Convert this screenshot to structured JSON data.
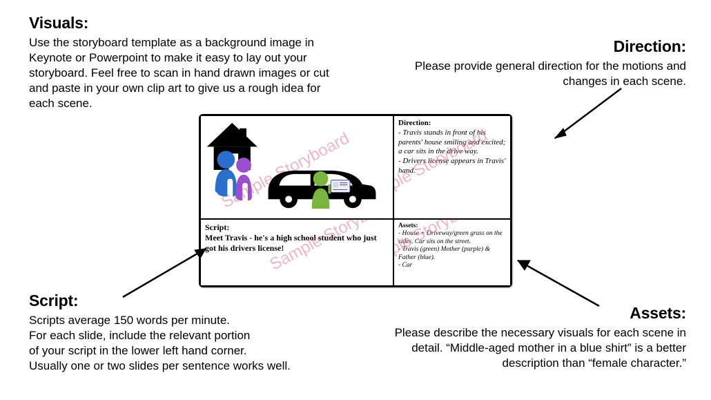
{
  "callouts": {
    "visuals": {
      "heading": "Visuals:",
      "body": "Use the storyboard template as a background image in Keynote or Powerpoint to make it easy to lay out your storyboard. Feel free to scan in hand drawn images or cut and paste in your own clip art to give us a rough idea for each scene."
    },
    "direction": {
      "heading": "Direction:",
      "body": "Please provide general direction for the motions and changes in each scene."
    },
    "script": {
      "heading": "Script:",
      "body": "Scripts average 150 words per minute.\nFor each slide, include the relevant portion\nof your script in the lower left hand corner.\nUsually one or two slides per sentence works well."
    },
    "assets": {
      "heading": "Assets:",
      "body": "Please describe the necessary visuals for each scene in detail. “Middle-aged mother in a blue shirt” is a better description than “female character.”"
    }
  },
  "storyboard": {
    "watermark_text": "Sample Storyboard",
    "direction": {
      "label": "Direction:",
      "body": "- Travis stands in front of his parents' house smiling and excited; a car sits in the drive way.\n- Drivers license appears in Travis' hand."
    },
    "script": {
      "label": "Script:",
      "body": "Meet Travis - he's a high school student who just got his drivers license!"
    },
    "assets": {
      "label": "Assets:",
      "body": "- House + Driveway/green grass on the sides. Car sits on the street.\n- Travis (green) Mother (purple) & Father (blue).\n- Car"
    }
  },
  "colors": {
    "father": "#2b6fce",
    "mother": "#9b4fcf",
    "travis": "#7bb53f",
    "car": "#000000",
    "house": "#000000"
  }
}
